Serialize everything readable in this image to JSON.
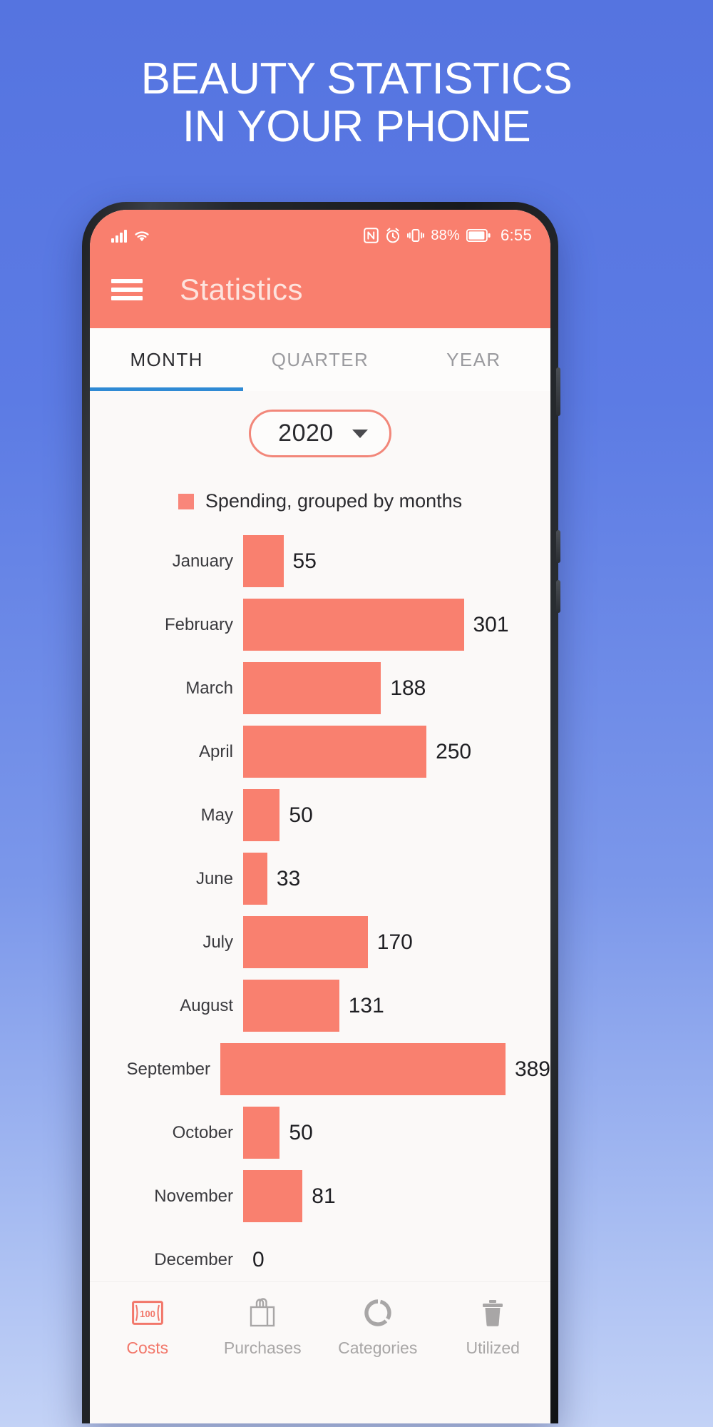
{
  "headline": {
    "line1": "BEAUTY STATISTICS",
    "line2": "IN YOUR PHONE"
  },
  "colors": {
    "accent": "#f97f6e",
    "bar": "#f9806f",
    "tab_underline": "#2f8ad4",
    "background": "#5574e0"
  },
  "statusbar": {
    "signal_icon": "signal-bars-icon",
    "wifi_icon": "wifi-icon",
    "nfc_icon": "nfc-icon",
    "alarm_icon": "alarm-clock-icon",
    "vibrate_icon": "vibrate-icon",
    "battery_percent": "88%",
    "battery_icon": "battery-icon",
    "time": "6:55"
  },
  "appbar": {
    "menu_icon": "hamburger-menu-icon",
    "title": "Statistics"
  },
  "tabs": [
    {
      "label": "MONTH",
      "active": true
    },
    {
      "label": "QUARTER",
      "active": false
    },
    {
      "label": "YEAR",
      "active": false
    }
  ],
  "year_selector": {
    "value": "2020",
    "caret_icon": "chevron-down-icon"
  },
  "chart_data": {
    "type": "bar",
    "orientation": "horizontal",
    "title": "",
    "legend": "Spending, grouped by months",
    "legend_position": "top-center",
    "grid": false,
    "xlabel": "",
    "ylabel": "",
    "xlim": [
      0,
      389
    ],
    "categories": [
      "January",
      "February",
      "March",
      "April",
      "May",
      "June",
      "July",
      "August",
      "September",
      "October",
      "November",
      "December"
    ],
    "values": [
      55,
      301,
      188,
      250,
      50,
      33,
      170,
      131,
      389,
      50,
      81,
      0
    ],
    "value_labels": [
      "55",
      "301",
      "188",
      "250",
      "50",
      "33",
      "170",
      "131",
      "389",
      "50",
      "81",
      "0"
    ]
  },
  "bottomnav": [
    {
      "label": "Costs",
      "icon": "banknote-100-icon",
      "active": true
    },
    {
      "label": "Purchases",
      "icon": "shopping-bag-icon",
      "active": false
    },
    {
      "label": "Categories",
      "icon": "donut-chart-icon",
      "active": false
    },
    {
      "label": "Utilized",
      "icon": "trash-bin-icon",
      "active": false
    }
  ]
}
